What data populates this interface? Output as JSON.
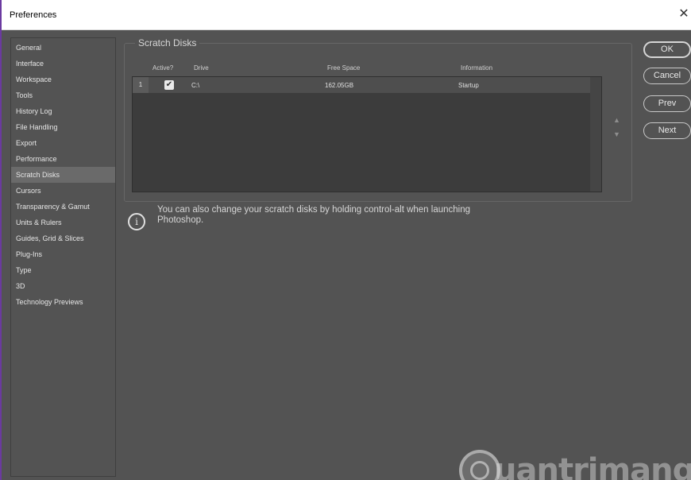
{
  "window": {
    "title": "Preferences",
    "close_glyph": "✕"
  },
  "sidebar": {
    "items": [
      {
        "label": "General"
      },
      {
        "label": "Interface"
      },
      {
        "label": "Workspace"
      },
      {
        "label": "Tools"
      },
      {
        "label": "History Log"
      },
      {
        "label": "File Handling"
      },
      {
        "label": "Export"
      },
      {
        "label": "Performance"
      },
      {
        "label": "Scratch Disks",
        "selected": true
      },
      {
        "label": "Cursors"
      },
      {
        "label": "Transparency & Gamut"
      },
      {
        "label": "Units & Rulers"
      },
      {
        "label": "Guides, Grid & Slices"
      },
      {
        "label": "Plug-Ins"
      },
      {
        "label": "Type"
      },
      {
        "label": "3D"
      },
      {
        "label": "Technology Previews"
      }
    ]
  },
  "scratch_disks": {
    "title": "Scratch Disks",
    "columns": {
      "active": "Active?",
      "drive": "Drive",
      "free_space": "Free Space",
      "information": "Information"
    },
    "rows": [
      {
        "num": "1",
        "active": true,
        "check_glyph": "✔",
        "drive": "C:\\",
        "free_space": "162.05GB",
        "information": "Startup"
      }
    ],
    "move_up_glyph": "▲",
    "move_down_glyph": "▼"
  },
  "info": {
    "icon": "info-icon",
    "glyph": "i",
    "text": "You can also change your scratch disks by holding control-alt when launching Photoshop."
  },
  "buttons": {
    "ok": "OK",
    "cancel": "Cancel",
    "prev": "Prev",
    "next": "Next"
  },
  "watermark": {
    "text": "uantrimang"
  },
  "colors": {
    "panel_bg": "#535353",
    "selected_item": "#6a6a6a",
    "title_border": "#6b3aa0"
  }
}
